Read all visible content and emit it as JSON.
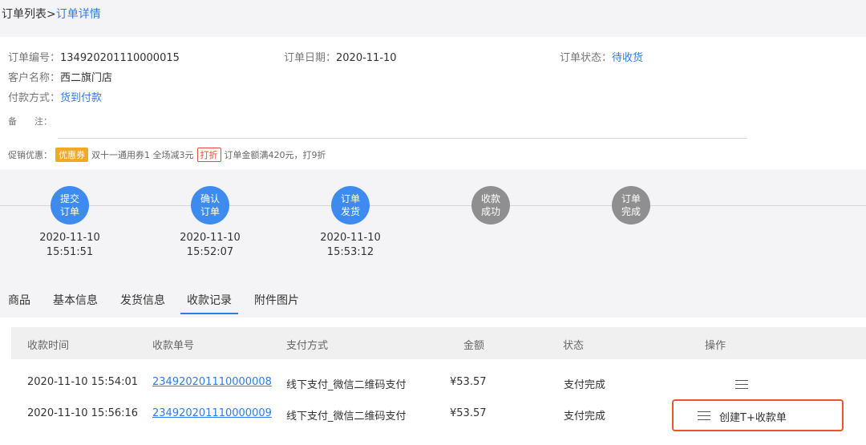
{
  "breadcrumb": {
    "parent": "订单列表",
    "separator": ">",
    "current": "订单详情"
  },
  "order": {
    "number_label": "订单编号：",
    "number": "134920201110000015",
    "date_label": "订单日期：",
    "date": "2020-11-10",
    "status_label": "订单状态：",
    "status": "待收货",
    "customer_label": "客户名称：",
    "customer": "西二旗门店",
    "payment_label": "付款方式：",
    "payment": "货到付款",
    "note_label": "备　　注："
  },
  "promo": {
    "label": "促销优惠：",
    "coupon_badge": "优惠券",
    "coupon_text": "双十一通用券1 全场减3元",
    "discount_badge": "打折",
    "discount_text": "订单金额满420元，打9折"
  },
  "steps": [
    {
      "line1": "提交",
      "line2": "订单",
      "date": "2020-11-10",
      "time": "15:51:51",
      "state": "done"
    },
    {
      "line1": "确认",
      "line2": "订单",
      "date": "2020-11-10",
      "time": "15:52:07",
      "state": "done"
    },
    {
      "line1": "订单",
      "line2": "发货",
      "date": "2020-11-10",
      "time": "15:53:12",
      "state": "done"
    },
    {
      "line1": "收款",
      "line2": "成功",
      "state": "pending"
    },
    {
      "line1": "订单",
      "line2": "完成",
      "state": "pending"
    }
  ],
  "tabs": [
    "商品",
    "基本信息",
    "发货信息",
    "收款记录",
    "附件图片"
  ],
  "active_tab": "收款记录",
  "table": {
    "headers": [
      "收款时间",
      "收款单号",
      "支付方式",
      "金额",
      "状态",
      "操作"
    ],
    "rows": [
      {
        "time": "2020-11-10 15:54:01",
        "number": "234920201110000008",
        "method": "线下支付_微信二维码支付",
        "amount": "¥53.57",
        "status": "支付完成",
        "action": ""
      },
      {
        "time": "2020-11-10 15:56:16",
        "number": "234920201110000009",
        "method": "线下支付_微信二维码支付",
        "amount": "¥53.57",
        "status": "支付完成",
        "action": "创建T+收款单"
      }
    ]
  },
  "colors": {
    "accent": "#2f7ce8",
    "step_done": "#3d8bef",
    "step_pending": "#8f8f8f",
    "highlight": "#e8562f"
  },
  "icons": {
    "action_icon": "list-icon"
  }
}
